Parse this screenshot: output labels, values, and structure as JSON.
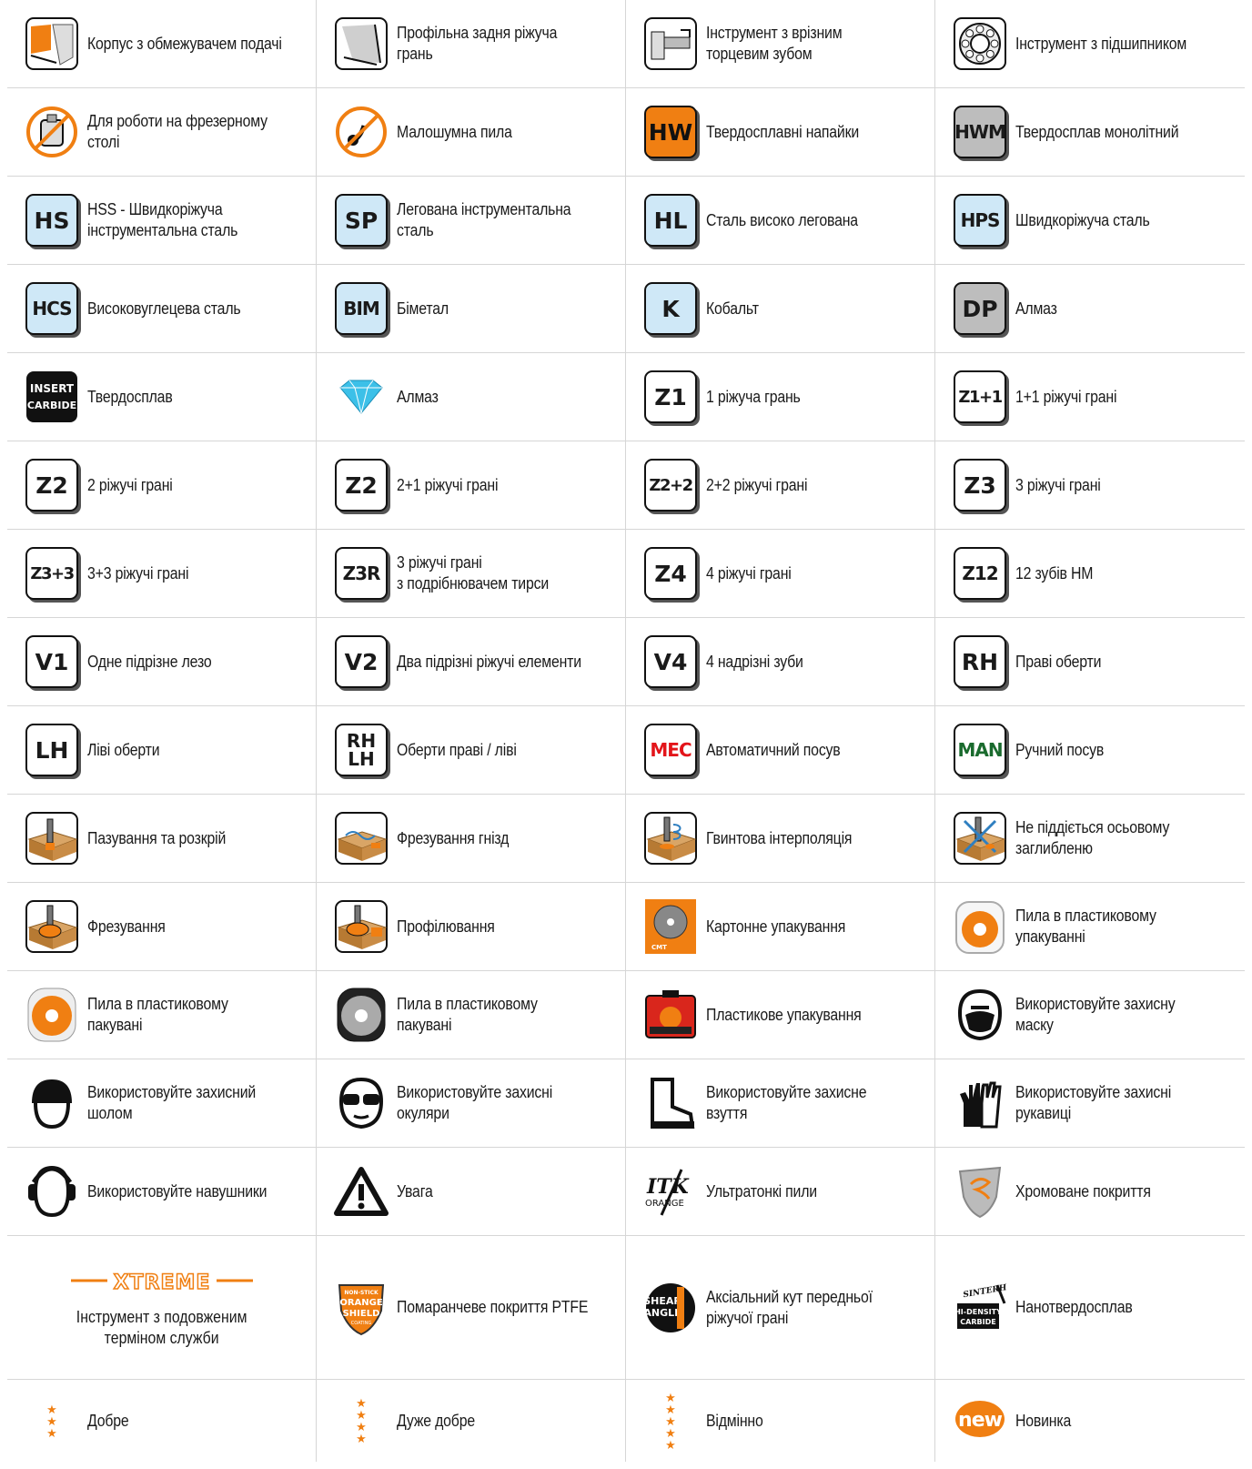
{
  "cells": [
    {
      "icon": "limiter-body-icon",
      "label": "Корпус з обмежувачем подачі"
    },
    {
      "icon": "back-profile-edge-icon",
      "label": "Профільна задня ріжуча\nгрань"
    },
    {
      "icon": "slotted-face-tooth-icon",
      "label": "Інструмент з врізним\nторцевим зубом"
    },
    {
      "icon": "bearing-icon",
      "label": "Інструмент з підшипником"
    },
    {
      "icon": "router-table-icon",
      "label": "Для роботи на фрезерному\nстолі"
    },
    {
      "icon": "low-noise-saw-icon",
      "label": "Малошумна пила"
    },
    {
      "icon": "badge",
      "badge": "HW",
      "badge_style": "orange",
      "label": "Твердосплавні напайки"
    },
    {
      "icon": "badge",
      "badge": "HWM",
      "badge_style": "grey",
      "label": "Твердосплав монолітний"
    },
    {
      "icon": "badge",
      "badge": "HS",
      "badge_style": "blue",
      "label": "HSS - Швидкоріжуча\nінструментальна сталь"
    },
    {
      "icon": "badge",
      "badge": "SP",
      "badge_style": "blue",
      "label": "Легована інструментальна\nсталь"
    },
    {
      "icon": "badge",
      "badge": "HL",
      "badge_style": "blue",
      "label": "Сталь високо легована"
    },
    {
      "icon": "badge",
      "badge": "HPS",
      "badge_style": "blue",
      "label": "Швидкоріжуча сталь"
    },
    {
      "icon": "badge",
      "badge": "HCS",
      "badge_style": "blue",
      "label": "Високовуглецева сталь"
    },
    {
      "icon": "badge",
      "badge": "BIM",
      "badge_style": "blue",
      "label": "Біметал"
    },
    {
      "icon": "badge",
      "badge": "K",
      "badge_style": "blue",
      "label": "Кобальт"
    },
    {
      "icon": "badge",
      "badge": "DP",
      "badge_style": "grey",
      "label": "Алмаз"
    },
    {
      "icon": "insert-carbide-icon",
      "badge_lines": [
        "INSERT",
        "CARBIDE"
      ],
      "label": "Твердосплав"
    },
    {
      "icon": "diamond-icon",
      "label": "Алмаз"
    },
    {
      "icon": "badge",
      "badge": "Z1",
      "label": "1 ріжуча грань"
    },
    {
      "icon": "badge",
      "badge": "Z1+1",
      "label": "1+1 ріжучі грані"
    },
    {
      "icon": "badge",
      "badge": "Z2",
      "label": "2 ріжучі грані"
    },
    {
      "icon": "badge",
      "badge": "Z2",
      "label": "2+1 ріжучі грані"
    },
    {
      "icon": "badge",
      "badge": "Z2+2",
      "label": "2+2 ріжучі грані"
    },
    {
      "icon": "badge",
      "badge": "Z3",
      "label": "3 ріжучі грані"
    },
    {
      "icon": "badge",
      "badge": "Z3+3",
      "label": "3+3 ріжучі грані"
    },
    {
      "icon": "badge",
      "badge": "Z3R",
      "label": "3 ріжучі грані\nз подрібнювачем тирси"
    },
    {
      "icon": "badge",
      "badge": "Z4",
      "label": "4 ріжучі грані"
    },
    {
      "icon": "badge",
      "badge": "Z12",
      "label": "12 зубів HM"
    },
    {
      "icon": "badge",
      "badge": "V1",
      "label": " Одне підрізне лезо"
    },
    {
      "icon": "badge",
      "badge": "V2",
      "label": "Два підрізні ріжучі елементи"
    },
    {
      "icon": "badge",
      "badge": "V4",
      "label": "4 надрізні зуби"
    },
    {
      "icon": "badge",
      "badge": "RH",
      "label": "Праві оберти"
    },
    {
      "icon": "badge",
      "badge": "LH",
      "label": "Ліві оберти"
    },
    {
      "icon": "badge",
      "badge_lines": [
        "RH",
        "LH"
      ],
      "label": "Оберти праві / ліві"
    },
    {
      "icon": "badge",
      "badge": "MEC",
      "badge_color": "#e3151a",
      "label": "Автоматичний посув"
    },
    {
      "icon": "badge",
      "badge": "MAN",
      "badge_color": "#1a6b2e",
      "label": "Ручний посув"
    },
    {
      "icon": "slotting-icon",
      "label": " Пазування та розкрій"
    },
    {
      "icon": "mortising-icon",
      "label": " Фрезування гнізд"
    },
    {
      "icon": "helical-interpolation-icon",
      "label": "Гвинтова інтерполяція"
    },
    {
      "icon": "no-plunge-icon",
      "label": " Не піддіється осьовому\nзаглибленю"
    },
    {
      "icon": "milling-icon",
      "label": "Фрезування"
    },
    {
      "icon": "profiling-icon",
      "label": " Профілювання"
    },
    {
      "icon": "cardboard-pack-icon",
      "label": "Картонне упакування"
    },
    {
      "icon": "plastic-case-saw-icon",
      "label": "Пила в пластиковому\nупакуванні"
    },
    {
      "icon": "plastic-pack-saw-orange-icon",
      "label": "Пила в пластиковому\nпакувані"
    },
    {
      "icon": "plastic-pack-saw-grey-icon",
      "label": "Пила в пластиковому\nпакувані"
    },
    {
      "icon": "plastic-case-icon",
      "label": "Пластикове упакування"
    },
    {
      "icon": "mask-icon",
      "label": "Використовуйте захисну\nмаску"
    },
    {
      "icon": "helmet-icon",
      "label": "Використовуйте захисний\nшолом"
    },
    {
      "icon": "goggles-icon",
      "label": "Використовуйте захисні\nокуляри"
    },
    {
      "icon": "boots-icon",
      "label": "Використовуйте захисне\nвзуття"
    },
    {
      "icon": "gloves-icon",
      "label": "Використовуйте захисні\nрукавиці"
    },
    {
      "icon": "ear-protection-icon",
      "label": "Використовуйте навушники"
    },
    {
      "icon": "warning-icon",
      "label": "Увага"
    },
    {
      "icon": "itk-orange-icon",
      "label": "Ультратонкі пили"
    },
    {
      "icon": "chrome-coating-icon",
      "label": "Хромоване покриття"
    }
  ],
  "xtreme": {
    "logo": "XTREME",
    "label": "Інструмент з подовженим\nтерміном служби"
  },
  "row_special": [
    {
      "icon": "orange-shield-icon",
      "logo_lines": [
        "NON-STICK",
        "ORANGE",
        "SHIELD",
        "COATING"
      ],
      "label": "Помаранчеве покриття PTFE"
    },
    {
      "icon": "shear-angle-icon",
      "logo_lines": [
        "SHEAR",
        "ANGLE"
      ],
      "label": "Аксіальний кут передньої\nріжучої грані"
    },
    {
      "icon": "sinterhip-icon",
      "logo_lines": [
        "SINTERHIP",
        "HI-DENSITY",
        "CARBIDE"
      ],
      "label": "Нанотвердосплав"
    }
  ],
  "ratings": [
    {
      "stars": "★\n★\n★",
      "label": "Добре"
    },
    {
      "stars": "★\n★\n★\n★",
      "label": "Дуже добре"
    },
    {
      "stars": "★\n★\n★\n★\n★",
      "label": "Відмінно"
    },
    {
      "new": "new",
      "label": "Новинка"
    }
  ],
  "colors": {
    "orange": "#f07f12",
    "badge_blue": "#cfe8f7",
    "badge_grey": "#bdbdbd",
    "divider": "#d6d6d6"
  }
}
